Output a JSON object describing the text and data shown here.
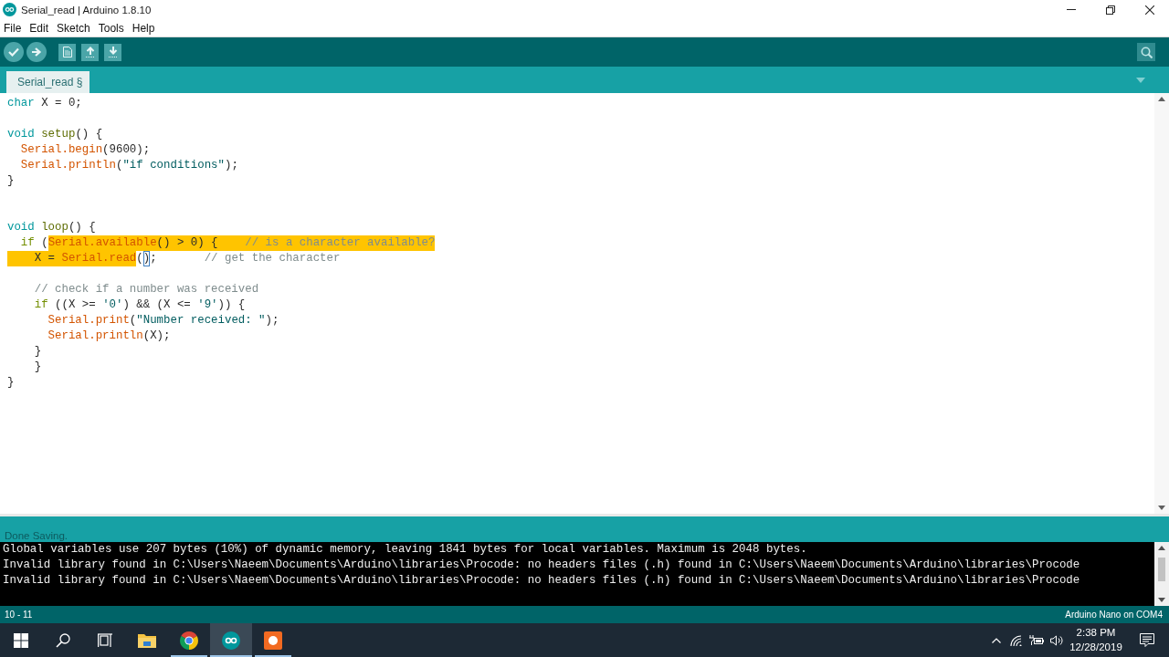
{
  "window": {
    "title": "Serial_read | Arduino 1.8.10"
  },
  "menu": [
    {
      "label": "File"
    },
    {
      "label": "Edit"
    },
    {
      "label": "Sketch"
    },
    {
      "label": "Tools"
    },
    {
      "label": "Help"
    }
  ],
  "tabs": [
    {
      "label": "Serial_read §",
      "selected": true
    }
  ],
  "editor": {
    "lines": [
      {
        "kind": "code",
        "tokens": [
          {
            "text": "char",
            "kind": "type",
            "selected": false
          },
          {
            "text": " X = 0;",
            "kind": "plain",
            "selected": false
          }
        ]
      },
      {
        "kind": "blank"
      },
      {
        "kind": "code",
        "tokens": [
          {
            "text": "void ",
            "kind": "type",
            "selected": false
          },
          {
            "text": "setup",
            "kind": "structure",
            "selected": false
          },
          {
            "text": "() {",
            "kind": "plain",
            "selected": false
          }
        ]
      },
      {
        "kind": "code",
        "tokens": [
          {
            "text": "  Serial.begin",
            "kind": "function",
            "selected": false
          },
          {
            "text": "(9600);",
            "kind": "plain",
            "selected": false
          }
        ]
      },
      {
        "kind": "code",
        "tokens": [
          {
            "text": "  Serial.println",
            "kind": "function",
            "selected": false
          },
          {
            "text": "(",
            "kind": "plain",
            "selected": false
          },
          {
            "text": "\"if conditions\"",
            "kind": "string",
            "selected": false
          },
          {
            "text": ");",
            "kind": "plain",
            "selected": false
          }
        ]
      },
      {
        "kind": "code",
        "tokens": [
          {
            "text": "}",
            "kind": "plain",
            "selected": false
          }
        ]
      },
      {
        "kind": "blank"
      },
      {
        "kind": "blank"
      },
      {
        "kind": "code",
        "tokens": [
          {
            "text": "void ",
            "kind": "type",
            "selected": false
          },
          {
            "text": "loop",
            "kind": "structure",
            "selected": false
          },
          {
            "text": "() {",
            "kind": "plain",
            "selected": false
          }
        ]
      },
      {
        "kind": "code",
        "tokens": [
          {
            "text": "  if",
            "kind": "control",
            "selected": false
          },
          {
            "text": " (",
            "kind": "plain",
            "selected": false
          },
          {
            "text": "Serial.available",
            "kind": "function",
            "selected": true
          },
          {
            "text": "() > 0) {    ",
            "kind": "plain",
            "selected": true
          },
          {
            "text": "// is a character available?",
            "kind": "comment",
            "selected": true
          }
        ]
      },
      {
        "kind": "code",
        "tokens": [
          {
            "text": "    X = ",
            "kind": "plain",
            "selected": true
          },
          {
            "text": "Serial.read",
            "kind": "function",
            "selected": true
          },
          {
            "text": "(",
            "kind": "plain",
            "selected": false
          },
          {
            "text": ")",
            "kind": "bracket-match",
            "selected": false
          },
          {
            "text": ";       ",
            "kind": "plain",
            "selected": false
          },
          {
            "text": "// get the character",
            "kind": "comment",
            "selected": false
          }
        ]
      },
      {
        "kind": "blank"
      },
      {
        "kind": "code",
        "tokens": [
          {
            "text": "    // check if a number was received",
            "kind": "comment",
            "selected": false
          }
        ]
      },
      {
        "kind": "code",
        "tokens": [
          {
            "text": "    if",
            "kind": "control",
            "selected": false
          },
          {
            "text": " ((X >= ",
            "kind": "plain",
            "selected": false
          },
          {
            "text": "'0'",
            "kind": "string",
            "selected": false
          },
          {
            "text": ") && (X <= ",
            "kind": "plain",
            "selected": false
          },
          {
            "text": "'9'",
            "kind": "string",
            "selected": false
          },
          {
            "text": ")) {",
            "kind": "plain",
            "selected": false
          }
        ]
      },
      {
        "kind": "code",
        "tokens": [
          {
            "text": "      Serial.print",
            "kind": "function",
            "selected": false
          },
          {
            "text": "(",
            "kind": "plain",
            "selected": false
          },
          {
            "text": "\"Number received: \"",
            "kind": "string",
            "selected": false
          },
          {
            "text": ");",
            "kind": "plain",
            "selected": false
          }
        ]
      },
      {
        "kind": "code",
        "tokens": [
          {
            "text": "      Serial.println",
            "kind": "function",
            "selected": false
          },
          {
            "text": "(X);",
            "kind": "plain",
            "selected": false
          }
        ]
      },
      {
        "kind": "code",
        "tokens": [
          {
            "text": "    }",
            "kind": "plain",
            "selected": false
          }
        ]
      },
      {
        "kind": "code",
        "tokens": [
          {
            "text": "    }",
            "kind": "plain",
            "selected": false
          }
        ]
      },
      {
        "kind": "code",
        "tokens": [
          {
            "text": "}",
            "kind": "plain",
            "selected": false
          }
        ]
      }
    ]
  },
  "status": {
    "message": "Done Saving."
  },
  "console": {
    "lines": [
      "Global variables use 207 bytes (10%) of dynamic memory, leaving 1841 bytes for local variables. Maximum is 2048 bytes.",
      "Invalid library found in C:\\Users\\Naeem\\Documents\\Arduino\\libraries\\Procode: no headers files (.h) found in C:\\Users\\Naeem\\Documents\\Arduino\\libraries\\Procode",
      "Invalid library found in C:\\Users\\Naeem\\Documents\\Arduino\\libraries\\Procode: no headers files (.h) found in C:\\Users\\Naeem\\Documents\\Arduino\\libraries\\Procode"
    ]
  },
  "footer": {
    "position": "10 - 11",
    "board": "Arduino Nano on COM4"
  },
  "taskbar": {
    "items": [
      {
        "kind": "start",
        "running": false,
        "selected": false
      },
      {
        "kind": "search",
        "running": false,
        "selected": false
      },
      {
        "kind": "task-view",
        "running": false,
        "selected": false
      },
      {
        "kind": "folder",
        "running": false,
        "selected": false
      },
      {
        "kind": "browser",
        "running": true,
        "selected": false
      },
      {
        "kind": "arduino",
        "running": true,
        "selected": true
      },
      {
        "kind": "recorder",
        "running": true,
        "selected": false
      }
    ]
  },
  "clock": {
    "time": "2:38 PM",
    "date": "12/28/2019"
  }
}
